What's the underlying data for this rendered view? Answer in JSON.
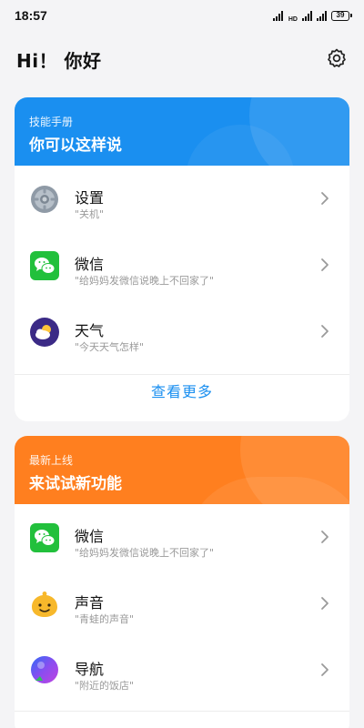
{
  "status_bar": {
    "time": "18:57",
    "network_label": "HD",
    "battery": "39"
  },
  "header": {
    "title": "Hi！ 你好",
    "settings_icon": "gear-icon"
  },
  "skills_card": {
    "kicker": "技能手册",
    "heading": "你可以这样说",
    "accent_color": "#1a8ff0",
    "items": [
      {
        "title": "设置",
        "subtitle": "\"关机\"",
        "icon": "settings-app-icon"
      },
      {
        "title": "微信",
        "subtitle": "\"给妈妈发微信说晚上不回家了\"",
        "icon": "wechat-icon"
      },
      {
        "title": "天气",
        "subtitle": "\"今天天气怎样\"",
        "icon": "weather-icon"
      }
    ],
    "more_label": "查看更多"
  },
  "new_card": {
    "kicker": "最新上线",
    "heading": "来试试新功能",
    "accent_color": "#ff7f1f",
    "items": [
      {
        "title": "微信",
        "subtitle": "\"给妈妈发微信说晚上不回家了\"",
        "icon": "wechat-icon"
      },
      {
        "title": "声音",
        "subtitle": "\"青蛙的声音\"",
        "icon": "sound-icon"
      },
      {
        "title": "导航",
        "subtitle": "\"附近的饭店\"",
        "icon": "navigation-icon"
      }
    ]
  }
}
